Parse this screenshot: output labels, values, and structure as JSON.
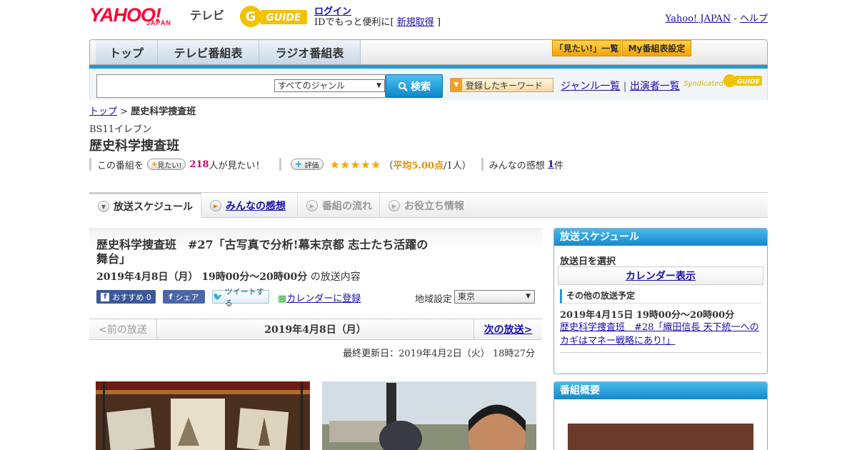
{
  "header": {
    "logo_yahoo": "YAHOO!",
    "logo_japan": "JAPAN",
    "logo_tv": "テレビ",
    "logo_gguide": "GUIDE",
    "login": "ログイン",
    "login_sub_prefix": "IDでもっと便利に[",
    "signup": "新規取得",
    "login_sub_suffix": "]",
    "yahoo_japan": "Yahoo! JAPAN",
    "separator": "-",
    "help": "ヘルプ"
  },
  "nav": {
    "tabs": [
      "トップ",
      "テレビ番組表",
      "ラジオ番組表"
    ],
    "want_list": "「見たい!」一覧",
    "my_schedule": "My番組表設定"
  },
  "search": {
    "genre": "すべてのジャンル",
    "button": "検索",
    "keyword_btn": "登録したキーワード",
    "genre_list": "ジャンル一覧",
    "divider": "|",
    "performers": "出演者一覧",
    "syndicated": "Syndicated",
    "syndicated_logo": "GUIDE"
  },
  "breadcrumb": {
    "top": "トップ",
    "sep": ">",
    "current": "歴史科学捜査班"
  },
  "program": {
    "channel": "BS11イレブン",
    "title": "歴史科学捜査班",
    "want_prefix": "この番組を",
    "want_btn": "見たい!",
    "want_count": "218",
    "want_suffix": "人が見たい！",
    "rating_btn": "評価",
    "stars": "★★★★★",
    "rating_open": "（",
    "rating_avg": "平均5.00点",
    "rating_tail": "/1人）",
    "reviews_label": "みんなの感想",
    "reviews_count": "1",
    "reviews_unit": "件"
  },
  "tabs": [
    {
      "label": "放送スケジュール"
    },
    {
      "label": "みんなの感想"
    },
    {
      "label": "番組の流れ"
    },
    {
      "label": "お役立ち情報"
    }
  ],
  "episode": {
    "title": "歴史科学捜査班　#27「古写真で分析!幕末京都 志士たち活躍の舞台」",
    "date": "2019年4月8日（月） 19時00分～20時00分",
    "date_suffix": "の放送内容",
    "recommend": "おすすめ 0",
    "share": "シェア",
    "tweet": "ツイートする",
    "calendar_add": "カレンダーに登録",
    "region_label": "地域設定",
    "region": "東京",
    "prev": "<前の放送",
    "current_date": "2019年4月8日（月）",
    "next": "次の放送>",
    "updated": "最終更新日：2019年4月2日（火） 18時27分"
  },
  "sidebar": {
    "schedule_title": "放送スケジュール",
    "select_date": "放送日を選択",
    "calendar": "カレンダー表示",
    "other_title": "その他の放送予定",
    "other_date": "2019年4月15日 19時00分～20時00分",
    "other_link": "歴史科学捜査班　#28「織田信長 天下統一へのカギはマネー戦略にあり!」",
    "overview_title": "番組概要"
  },
  "colors": {
    "accent_blue": "#1e9ad6",
    "yahoo_red": "#ff0033",
    "star_orange": "#f5a800",
    "want_pink": "#d6006e"
  }
}
